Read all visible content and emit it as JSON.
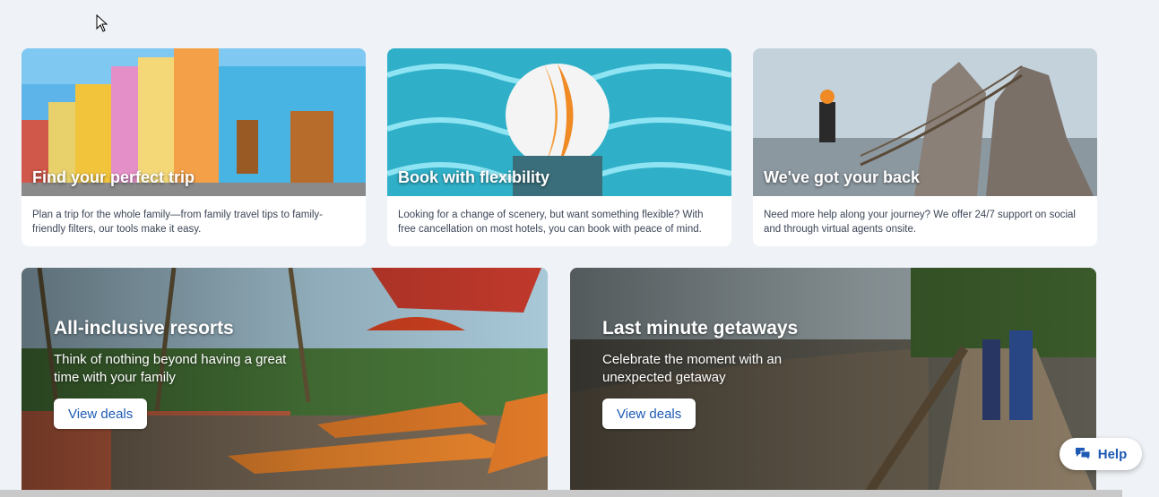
{
  "cards": [
    {
      "title": "Find your perfect trip",
      "description": "Plan a trip for the whole family—from family travel tips to family-friendly filters, our tools make it easy."
    },
    {
      "title": "Book with flexibility",
      "description": "Looking for a change of scenery, but want something flexible? With free cancellation on most hotels, you can book with peace of mind."
    },
    {
      "title": "We've got your back",
      "description": "Need more help along your journey? We offer 24/7 support on social and through virtual agents onsite."
    }
  ],
  "promos": [
    {
      "title": "All-inclusive resorts",
      "subtitle": "Think of nothing beyond having a great time with your family",
      "button": "View deals"
    },
    {
      "title": "Last minute getaways",
      "subtitle": "Celebrate the moment with an unexpected getaway",
      "button": "View deals"
    }
  ],
  "help": {
    "label": "Help"
  },
  "colors": {
    "accent": "#1e5ab4",
    "background": "#eff2f6"
  }
}
